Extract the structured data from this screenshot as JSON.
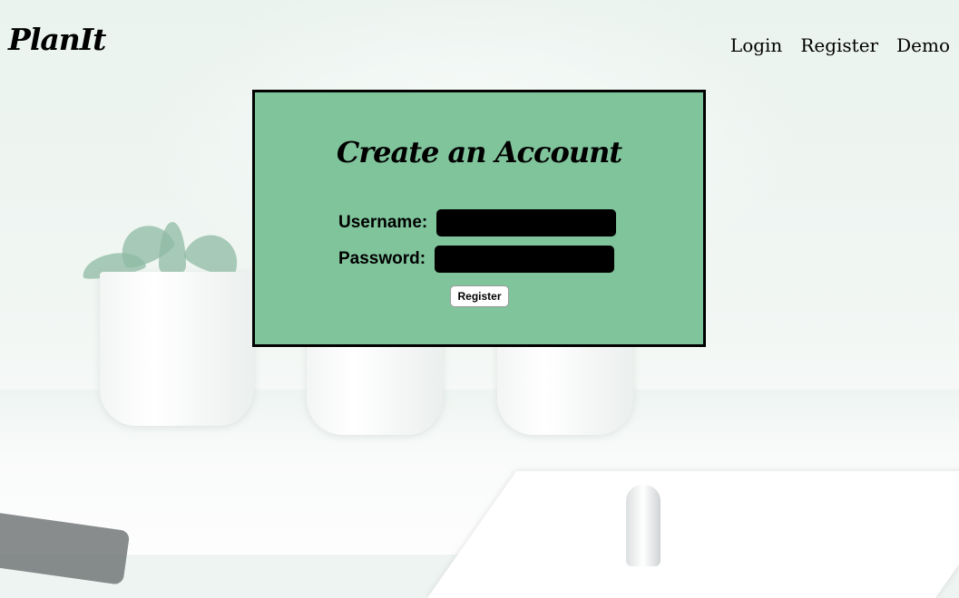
{
  "header": {
    "logo": "PlanIt",
    "nav": [
      {
        "label": "Login"
      },
      {
        "label": "Register"
      },
      {
        "label": "Demo"
      }
    ]
  },
  "form": {
    "title": "Create an Account",
    "username_label": "Username:",
    "username_value": "",
    "password_label": "Password:",
    "password_value": "",
    "submit_label": "Register"
  },
  "colors": {
    "card_background": "#80c49c",
    "input_background": "#000000"
  }
}
